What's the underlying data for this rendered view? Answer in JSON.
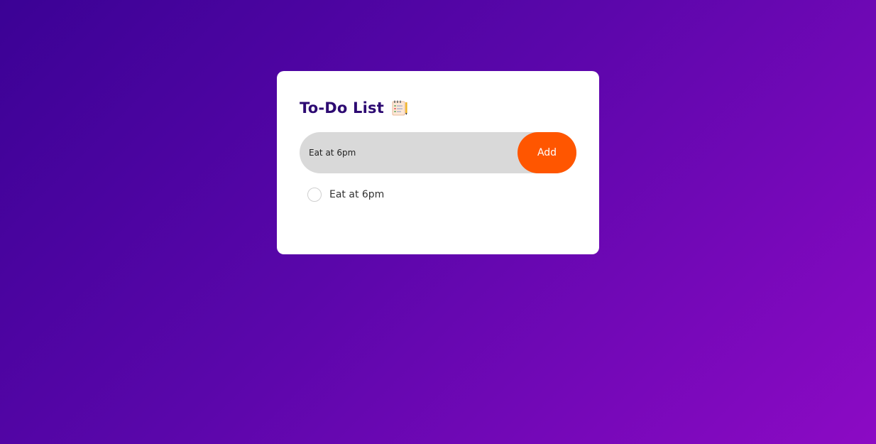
{
  "app": {
    "title": "To-Do List",
    "title_icon": "notepad-with-checklist-icon"
  },
  "form": {
    "input_value": "Eat at 6pm",
    "add_label": "Add"
  },
  "tasks": [
    {
      "text": "Eat at 6pm",
      "completed": false
    }
  ],
  "colors": {
    "background_start": "#3b0295",
    "background_end": "#8c0ac4",
    "title": "#2d0a72",
    "accent": "#ff5600",
    "input_bg": "#d9d9d9",
    "card_bg": "#ffffff"
  }
}
